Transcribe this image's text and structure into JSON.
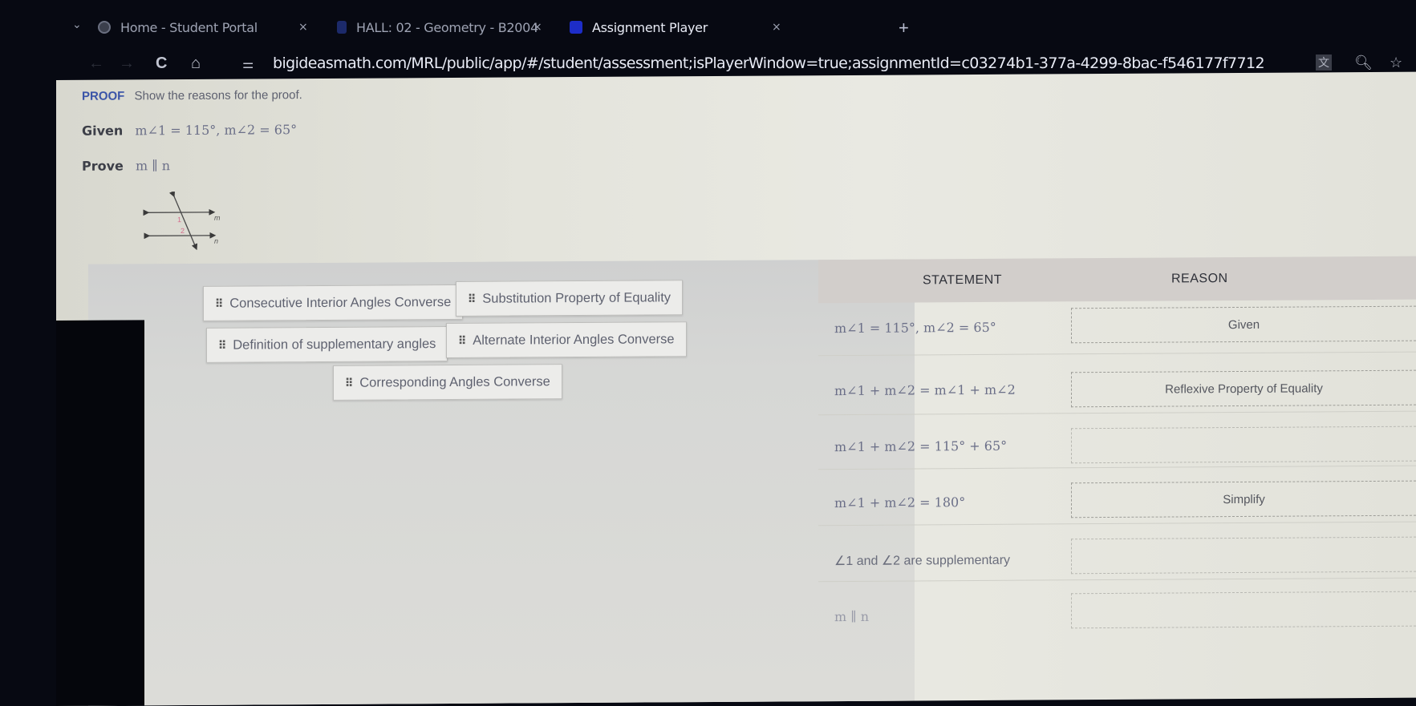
{
  "browser": {
    "tabs": [
      {
        "title": "Home - Student Portal",
        "icon": "globe-icon",
        "active": false
      },
      {
        "title": "HALL: 02 - Geometry - B2004",
        "icon": "shield-icon",
        "active": false
      },
      {
        "title": "Assignment Player",
        "icon": "b-logo-icon",
        "active": true
      }
    ],
    "close_glyph": "×",
    "new_tab_glyph": "+",
    "tab_list_glyph": "⌄",
    "url": "bigideasmath.com/MRL/public/app/#/student/assessment;isPlayerWindow=true;assignmentId=c03274b1-377a-4299-8bac-f546177f7712",
    "icons": {
      "back": "←",
      "forward": "→",
      "reload": "C",
      "home": "⌂",
      "site_info": "⚌",
      "translate": "文",
      "zoom": "🔍︎",
      "bookmark": "☆"
    }
  },
  "problem": {
    "keyword": "PROOF",
    "instruction": "Show the reasons for the proof.",
    "given_label": "Given",
    "given_math": "m∠1 = 115°, m∠2 = 65°",
    "prove_label": "Prove",
    "prove_math": "m ∥ n",
    "diagram": {
      "lines": [
        "m",
        "n"
      ],
      "angles": [
        "1",
        "2"
      ]
    }
  },
  "answer_bank": {
    "grip_glyph": "⠿",
    "options": [
      "Consecutive Interior Angles Converse",
      "Substitution Property of Equality",
      "Definition of supplementary angles",
      "Alternate Interior Angles Converse",
      "Corresponding Angles Converse"
    ]
  },
  "proof_table": {
    "headers": {
      "statement": "STATEMENT",
      "reason": "REASON"
    },
    "rows": [
      {
        "statement": "m∠1 = 115°, m∠2 = 65°",
        "reason": "Given"
      },
      {
        "statement": "m∠1 + m∠2 = m∠1 + m∠2",
        "reason": "Reflexive Property of Equality"
      },
      {
        "statement": "m∠1 + m∠2 = 115° + 65°",
        "reason": ""
      },
      {
        "statement": "m∠1 + m∠2 = 180°",
        "reason": "Simplify"
      },
      {
        "statement": "∠1 and ∠2 are supplementary",
        "reason": ""
      },
      {
        "statement": "m ∥ n",
        "reason": ""
      }
    ]
  }
}
